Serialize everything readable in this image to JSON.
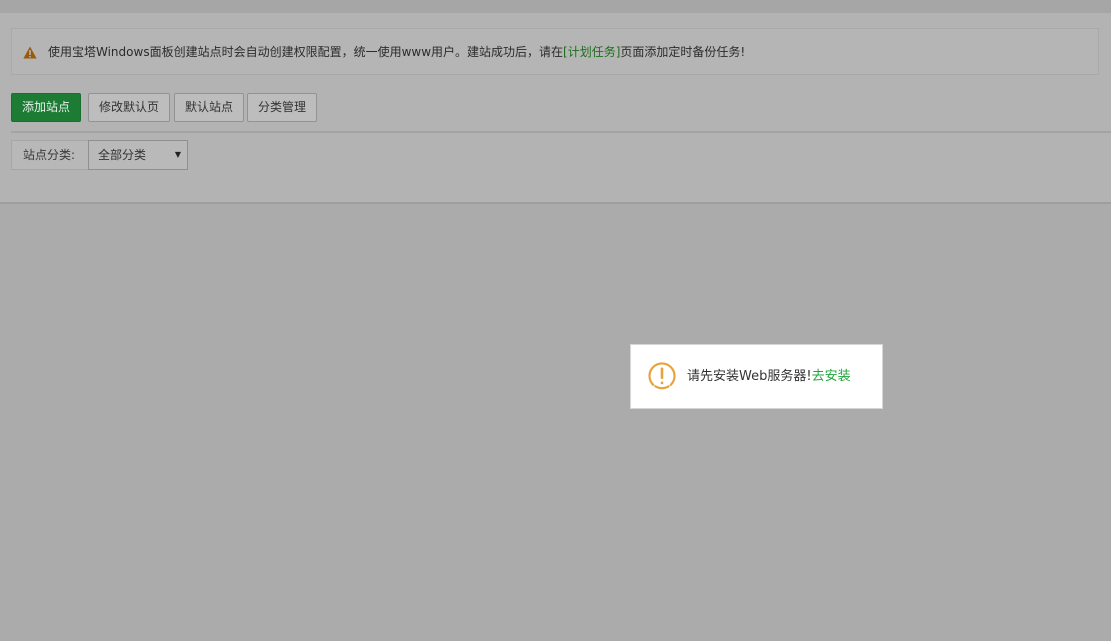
{
  "notice": {
    "icon": "warning-triangle-icon",
    "text_before": "使用宝塔Windows面板创建站点时会自动创建权限配置，统一使用www用户。建站成功后，请在",
    "link_text": "[计划任务]",
    "text_after": "页面添加定时备份任务!"
  },
  "toolbar": {
    "add_site_label": "添加站点",
    "edit_default_page_label": "修改默认页",
    "default_site_label": "默认站点",
    "category_manage_label": "分类管理"
  },
  "filter": {
    "label": "站点分类:",
    "selected": "全部分类"
  },
  "toast": {
    "icon": "exclamation-circle-icon",
    "message": "请先安装Web服务器!",
    "link_text": "去安装"
  },
  "colors": {
    "accent_green": "#20a53a",
    "warning_orange": "#e8a33b",
    "overlay": "#ababab"
  }
}
